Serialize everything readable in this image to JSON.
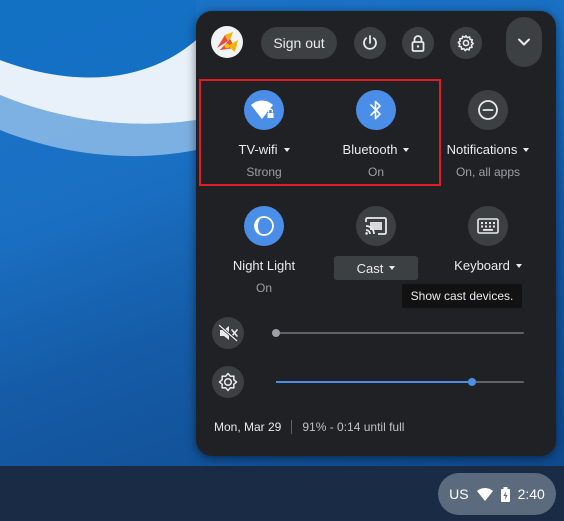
{
  "panel": {
    "signout_label": "Sign out",
    "tiles": [
      {
        "label": "TV-wifi",
        "sublabel": "Strong",
        "state": "on",
        "icon": "wifi-icon"
      },
      {
        "label": "Bluetooth",
        "sublabel": "On",
        "state": "on",
        "icon": "bluetooth-icon"
      },
      {
        "label": "Notifications",
        "sublabel": "On, all apps",
        "state": "off",
        "icon": "do-not-disturb-icon"
      },
      {
        "label": "Night Light",
        "sublabel": "On",
        "state": "on",
        "icon": "night-light-icon"
      },
      {
        "label": "Cast",
        "sublabel": "",
        "state": "off",
        "icon": "cast-icon"
      },
      {
        "label": "Keyboard",
        "sublabel": "",
        "state": "off",
        "icon": "keyboard-icon"
      }
    ],
    "tooltip": "Show cast devices.",
    "volume": {
      "muted": true,
      "level": 0
    },
    "brightness": {
      "level": 0.79
    },
    "date": "Mon, Mar 29",
    "battery": "91% - 0:14 until full"
  },
  "shelf": {
    "ime": "US",
    "time": "2:40"
  },
  "colors": {
    "accent": "#4b8ee8",
    "highlight": "#e01c24",
    "panel_bg": "#202124"
  }
}
